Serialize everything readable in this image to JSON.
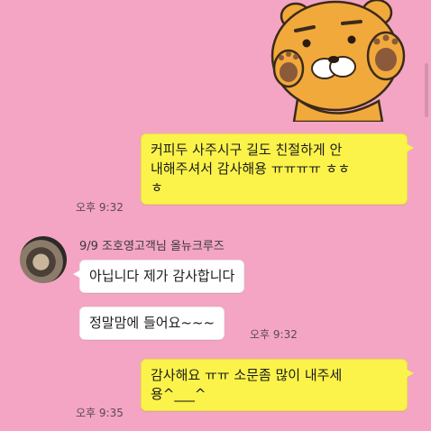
{
  "chat": {
    "sticker": {
      "name": "ryan-sticker",
      "colors": {
        "fur": "#f2a93b",
        "outline": "#3a2a1a",
        "paw": "#8a5a3a"
      }
    },
    "messages": [
      {
        "side": "me",
        "lines": [
          "커피두 사주시구 길도 친절하게 안",
          "내해주셔서 감사해용 ㅠㅠㅠㅠ ㅎㅎ",
          "ㅎ"
        ],
        "time": "오후 9:32"
      },
      {
        "side": "other",
        "sender": "9/9 조호영고객님 올뉴크루즈",
        "bubbles": [
          {
            "text": "아닙니다 제가 감사합니다"
          },
          {
            "text": "정말맘에 들어요~~~"
          }
        ],
        "time": "오후 9:32"
      },
      {
        "side": "me",
        "lines": [
          "감사해요 ㅠㅠ 소문좀 많이 내주세",
          "용^___^"
        ],
        "time": "오후 9:35"
      }
    ]
  },
  "colors": {
    "background": "#f3a5c3",
    "my_bubble": "#fbf34a",
    "other_bubble": "#ffffff"
  }
}
